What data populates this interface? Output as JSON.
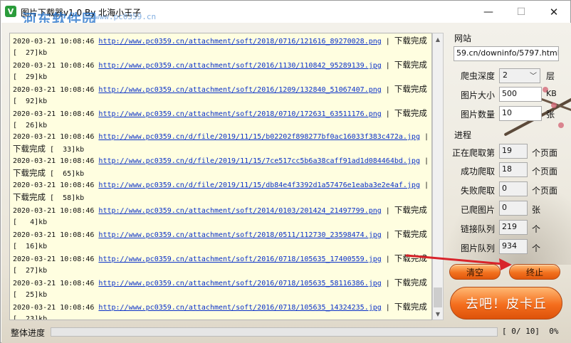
{
  "window": {
    "title": "图片下载器v1.0 By 北海小王子",
    "watermark": "河东软件园",
    "watermark_url": "www.pc0359.cn",
    "min_glyph": "—",
    "max_glyph": "☐",
    "close_glyph": "✕"
  },
  "log": {
    "lines": [
      {
        "ts": "2020-03-21 10:08:46",
        "url": "http://www.pc0359.cn/attachment/soft/2018/0716/121616_89270028.png",
        "sep": " | ",
        "status": "下载完成"
      },
      {
        "text": "[  27]kb"
      },
      {
        "ts": "2020-03-21 10:08:46",
        "url": "http://www.pc0359.cn/attachment/soft/2016/1130/110842_95289139.jpg",
        "sep": " | ",
        "status": "下载完成"
      },
      {
        "text": "[  29]kb"
      },
      {
        "ts": "2020-03-21 10:08:46",
        "url": "http://www.pc0359.cn/attachment/soft/2016/1209/132840_51067407.png",
        "sep": " | ",
        "status": "下载完成"
      },
      {
        "text": "[  92]kb"
      },
      {
        "ts": "2020-03-21 10:08:46",
        "url": "http://www.pc0359.cn/attachment/soft/2018/0710/172631_63511176.png",
        "sep": " | ",
        "status": "下载完成"
      },
      {
        "text": "[  26]kb"
      },
      {
        "ts": "2020-03-21 10:08:46",
        "url": "http://www.pc0359.cn/d/file/2019/11/15/b02202f898277bf0ac16033f383c472a.jpg",
        "sep": " |",
        "status": ""
      },
      {
        "status_lead": "下载完成",
        "text": " [  33]kb"
      },
      {
        "ts": "2020-03-21 10:08:46",
        "url": "http://www.pc0359.cn/d/file/2019/11/15/7ce517cc5b6a38caff91ad1d084464bd.jpg",
        "sep": " |",
        "status": ""
      },
      {
        "status_lead": "下载完成",
        "text": " [  65]kb"
      },
      {
        "ts": "2020-03-21 10:08:46",
        "url": "http://www.pc0359.cn/d/file/2019/11/15/db84e4f3392d1a57476e1eaba3e2e4af.jpg",
        "sep": " |",
        "status": ""
      },
      {
        "status_lead": "下载完成",
        "text": " [  58]kb"
      },
      {
        "ts": "2020-03-21 10:08:46",
        "url": "http://www.pc0359.cn/attachment/soft/2014/0103/201424_21497799.png",
        "sep": " | ",
        "status": "下载完成"
      },
      {
        "text": "[   4]kb"
      },
      {
        "ts": "2020-03-21 10:08:46",
        "url": "http://www.pc0359.cn/attachment/soft/2018/0511/112730_23598474.jpg",
        "sep": " | ",
        "status": "下载完成"
      },
      {
        "text": "[  16]kb"
      },
      {
        "ts": "2020-03-21 10:08:46",
        "url": "http://www.pc0359.cn/attachment/soft/2016/0718/105635_17400559.jpg",
        "sep": " | ",
        "status": "下载完成"
      },
      {
        "text": "[  27]kb"
      },
      {
        "ts": "2020-03-21 10:08:46",
        "url": "http://www.pc0359.cn/attachment/soft/2016/0718/105635_58116386.jpg",
        "sep": " | ",
        "status": "下载完成"
      },
      {
        "text": "[  25]kb"
      },
      {
        "ts": "2020-03-21 10:08:46",
        "url": "http://www.pc0359.cn/attachment/soft/2016/0718/105635_14324235.jpg",
        "sep": " | ",
        "status": "下载完成"
      },
      {
        "text": "[  23]kb"
      }
    ]
  },
  "panel": {
    "site_label": "网站",
    "site_value": "59.cn/downinfo/5797.html",
    "depth_label": "爬虫深度",
    "depth_value": "2",
    "depth_unit": "层",
    "size_label": "图片大小",
    "size_value": "500",
    "size_unit": "KB",
    "count_label": "图片数量",
    "count_value": "10",
    "count_unit": "张",
    "progress_group": "进程",
    "crawling_label": "正在爬取第",
    "crawling_value": "19",
    "crawling_unit": "个页面",
    "success_label": "成功爬取",
    "success_value": "18",
    "success_unit": "个页面",
    "fail_label": "失败爬取",
    "fail_value": "0",
    "fail_unit": "个页面",
    "crawled_img_label": "已爬图片",
    "crawled_img_value": "0",
    "crawled_img_unit": "张",
    "link_queue_label": "链接队列",
    "link_queue_value": "219",
    "link_queue_unit": "个",
    "img_queue_label": "图片队列",
    "img_queue_value": "934",
    "img_queue_unit": "个",
    "clear_button": "清空",
    "stop_button": "终止",
    "go_button": "去吧！皮卡丘"
  },
  "status": {
    "label": "整体进度",
    "progress_fraction": 0.0,
    "progress_text": "[ 0/ 10]  0%"
  },
  "colors": {
    "log_bg": "#fffee0",
    "link": "#0a31c8",
    "button_orange": "#f2711f",
    "arrow_red": "#d8242b"
  }
}
